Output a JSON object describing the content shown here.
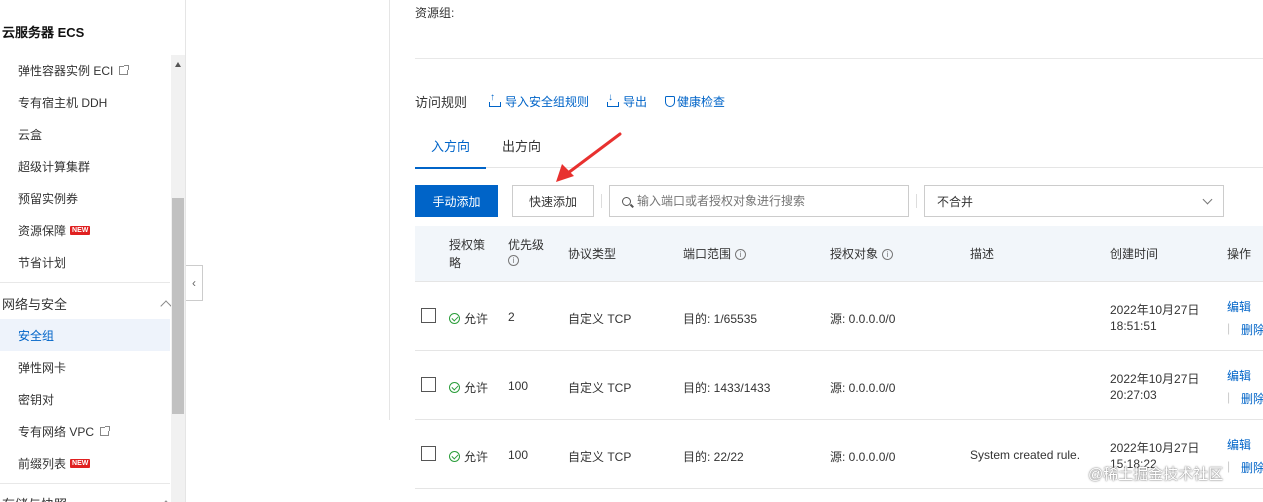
{
  "sidebar": {
    "title": "云服务器 ECS",
    "items": [
      {
        "label": "弹性容器实例 ECI",
        "ext": true
      },
      {
        "label": "专有宿主机 DDH"
      },
      {
        "label": "云盒"
      },
      {
        "label": "超级计算集群"
      },
      {
        "label": "预留实例券"
      },
      {
        "label": "资源保障",
        "badge": "NEW"
      },
      {
        "label": "节省计划"
      }
    ],
    "section_network": "网络与安全",
    "net_items": [
      {
        "label": "安全组",
        "active": true
      },
      {
        "label": "弹性网卡"
      },
      {
        "label": "密钥对"
      },
      {
        "label": "专有网络 VPC",
        "ext": true
      },
      {
        "label": "前缀列表",
        "badge": "NEW"
      }
    ],
    "section_next": "存储与快照"
  },
  "main": {
    "resource_group_label": "资源组:",
    "rules_label": "访问规则",
    "import_link": "导入安全组规则",
    "export_link": "导出",
    "health_link": "健康检查",
    "tabs": [
      "入方向",
      "出方向"
    ],
    "add_button": "手动添加",
    "quick_add_button": "快速添加",
    "search_placeholder": "输入端口或者授权对象进行搜索",
    "merge_select": "不合并"
  },
  "table": {
    "headers": {
      "policy": "授权策略",
      "priority": "优先级",
      "protocol": "协议类型",
      "port_range": "端口范围",
      "auth_object": "授权对象",
      "description": "描述",
      "created": "创建时间",
      "ops": "操作"
    },
    "rows": [
      {
        "policy": "允许",
        "priority": "2",
        "protocol": "自定义 TCP",
        "port": "目的: 1/65535",
        "object": "源: 0.0.0.0/0",
        "desc": "",
        "date": "2022年10月27日",
        "time": "18:51:51",
        "edit": "编辑",
        "delete": "删除"
      },
      {
        "policy": "允许",
        "priority": "100",
        "protocol": "自定义 TCP",
        "port": "目的: 1433/1433",
        "object": "源: 0.0.0.0/0",
        "desc": "",
        "date": "2022年10月27日",
        "time": "20:27:03",
        "edit": "编辑",
        "delete": "删除"
      },
      {
        "policy": "允许",
        "priority": "100",
        "protocol": "自定义 TCP",
        "port": "目的: 22/22",
        "object": "源: 0.0.0.0/0",
        "desc": "System created rule.",
        "date": "2022年10月27日",
        "time": "15:18:22",
        "edit": "编辑",
        "delete": "删除"
      }
    ]
  },
  "watermark": "@稀土掘金技术社区",
  "colors": {
    "accent": "#0064c8",
    "success": "#2a9d3a",
    "badge": "#e02020",
    "arrow": "#e8312f"
  }
}
